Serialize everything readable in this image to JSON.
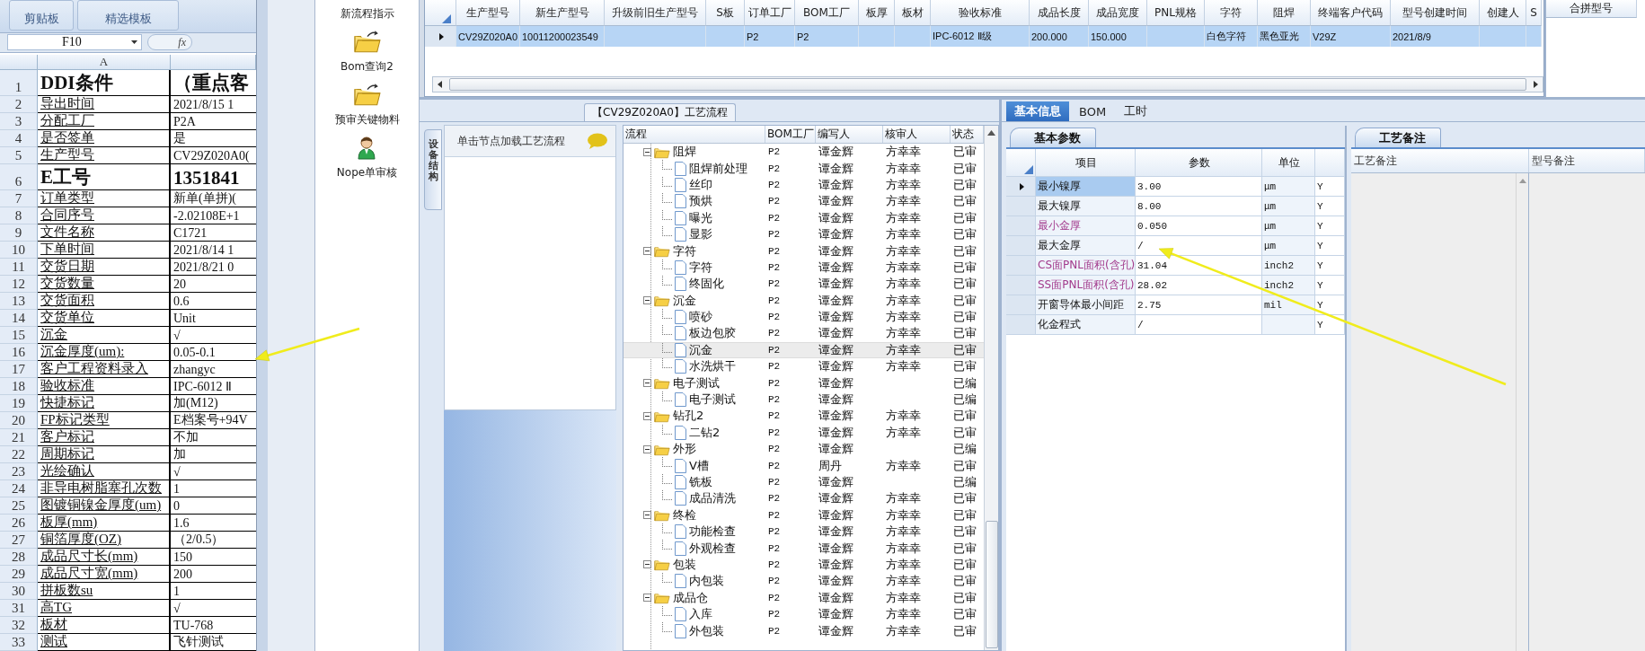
{
  "excel": {
    "ribbon_groups": [
      "剪贴板",
      "精选模板"
    ],
    "name_box": "F10",
    "formula_label": "fx",
    "column_header": "A",
    "rows": [
      {
        "num": "1",
        "a": "DDI条件",
        "b": "（重点客",
        "kind": "title"
      },
      {
        "num": "2",
        "a": "导出时间",
        "b": "2021/8/15 1",
        "kind": "normal"
      },
      {
        "num": "3",
        "a": "分配工厂",
        "b": "P2A",
        "kind": "normal"
      },
      {
        "num": "4",
        "a": "是否签单",
        "b": "是",
        "kind": "normal"
      },
      {
        "num": "5",
        "a": "生产型号",
        "b": "CV29Z020A0(",
        "kind": "normal"
      },
      {
        "num": "6",
        "a": "E工号",
        "b": "1351841",
        "kind": "title"
      },
      {
        "num": "7",
        "a": "订单类型",
        "b": "新单(单拼)(",
        "kind": "normal"
      },
      {
        "num": "8",
        "a": "合同序号",
        "b": "-2.02108E+1",
        "kind": "normal"
      },
      {
        "num": "9",
        "a": "文件名称",
        "b": "C1721",
        "kind": "normal"
      },
      {
        "num": "10",
        "a": "下单时间",
        "b": "2021/8/14 1",
        "kind": "normal"
      },
      {
        "num": "11",
        "a": "交货日期",
        "b": "2021/8/21 0",
        "kind": "normal"
      },
      {
        "num": "12",
        "a": "交货数量",
        "b": "20",
        "kind": "normal"
      },
      {
        "num": "13",
        "a": "交货面积",
        "b": "0.6",
        "kind": "normal"
      },
      {
        "num": "14",
        "a": "交货单位",
        "b": "Unit",
        "kind": "normal"
      },
      {
        "num": "15",
        "a": "沉金",
        "b": "√",
        "kind": "normal"
      },
      {
        "num": "16",
        "a": "沉金厚度(um):",
        "b": "0.05-0.1",
        "kind": "normal"
      },
      {
        "num": "17",
        "a": "客户工程资料录入",
        "b": "zhangyc",
        "kind": "normal"
      },
      {
        "num": "18",
        "a": "验收标准",
        "b": "IPC-6012 Ⅱ",
        "kind": "normal"
      },
      {
        "num": "19",
        "a": "快捷标记",
        "b": "加(M12)",
        "kind": "normal"
      },
      {
        "num": "20",
        "a": "FP标记类型",
        "b": "E档案号+94V",
        "kind": "normal"
      },
      {
        "num": "21",
        "a": "客户标记",
        "b": "不加",
        "kind": "normal"
      },
      {
        "num": "22",
        "a": "周期标记",
        "b": "加",
        "kind": "normal"
      },
      {
        "num": "23",
        "a": "光绘确认",
        "b": "√",
        "kind": "normal"
      },
      {
        "num": "24",
        "a": "非导电树脂塞孔次数",
        "b": "1",
        "kind": "normal"
      },
      {
        "num": "25",
        "a": "图镀铜镍金厚度(um)",
        "b": "0",
        "kind": "normal"
      },
      {
        "num": "26",
        "a": "板厚(mm)",
        "b": "1.6",
        "kind": "normal"
      },
      {
        "num": "27",
        "a": "铜箔厚度(OZ)",
        "b": "（2/0.5）",
        "kind": "normal"
      },
      {
        "num": "28",
        "a": "成品尺寸长(mm)",
        "b": "150",
        "kind": "normal"
      },
      {
        "num": "29",
        "a": "成品尺寸宽(mm)",
        "b": "200",
        "kind": "normal"
      },
      {
        "num": "30",
        "a": "拼板数su",
        "b": "1",
        "kind": "normal"
      },
      {
        "num": "31",
        "a": "高TG",
        "b": "√",
        "kind": "normal"
      },
      {
        "num": "32",
        "a": "板材",
        "b": "TU-768",
        "kind": "normal"
      },
      {
        "num": "33",
        "a": "测试",
        "b": "飞针测试",
        "kind": "normal"
      }
    ]
  },
  "nav": [
    {
      "label": "新流程指示",
      "kind": "label"
    },
    {
      "label": "Bom查询2",
      "kind": "folder"
    },
    {
      "label": "预审关键物料",
      "kind": "folder"
    },
    {
      "label": "Nope单审核",
      "kind": "person"
    }
  ],
  "top_grid": {
    "columns": [
      "生产型号",
      "新生产型号",
      "升级前旧生产型号",
      "S板",
      "订单工厂",
      "BOM工厂",
      "板厚",
      "板材",
      "验收标准",
      "成品长度",
      "成品宽度",
      "PNL规格",
      "字符",
      "阻焊",
      "终端客户代码",
      "型号创建时间",
      "创建人",
      "S"
    ],
    "rows": [
      {
        "selected": true,
        "cells": [
          "CV29Z020A0",
          "10011200023549",
          "",
          "",
          "P2",
          "P2",
          "",
          "",
          "IPC-6012 Ⅱ级",
          "200.000",
          "150.000",
          "",
          "白色字符",
          "黑色亚光",
          "V29Z",
          "2021/8/9",
          "",
          ""
        ]
      }
    ]
  },
  "merge_panel": {
    "header": "合拼型号"
  },
  "process": {
    "title": "【CV29Z020A0】工艺流程",
    "side_tab": "设备结构",
    "hint": "单击节点加载工艺流程",
    "columns": [
      "流程",
      "BOM工厂",
      "编写人",
      "核审人",
      "状态"
    ],
    "tree": [
      {
        "name": "阻焊",
        "bom": "P2",
        "author": "谭金辉",
        "reviewer": "方幸幸",
        "status": "已审",
        "expanded": true,
        "selected": false,
        "children": [
          {
            "name": "阻焊前处理",
            "bom": "P2",
            "author": "谭金辉",
            "reviewer": "方幸幸",
            "status": "已审",
            "selected": false
          },
          {
            "name": "丝印",
            "bom": "P2",
            "author": "谭金辉",
            "reviewer": "方幸幸",
            "status": "已审",
            "selected": false
          },
          {
            "name": "预烘",
            "bom": "P2",
            "author": "谭金辉",
            "reviewer": "方幸幸",
            "status": "已审",
            "selected": false
          },
          {
            "name": "曝光",
            "bom": "P2",
            "author": "谭金辉",
            "reviewer": "方幸幸",
            "status": "已审",
            "selected": false
          },
          {
            "name": "显影",
            "bom": "P2",
            "author": "谭金辉",
            "reviewer": "方幸幸",
            "status": "已审",
            "selected": false
          }
        ]
      },
      {
        "name": "字符",
        "bom": "P2",
        "author": "谭金辉",
        "reviewer": "方幸幸",
        "status": "已审",
        "expanded": true,
        "selected": false,
        "children": [
          {
            "name": "字符",
            "bom": "P2",
            "author": "谭金辉",
            "reviewer": "方幸幸",
            "status": "已审",
            "selected": false
          },
          {
            "name": "终固化",
            "bom": "P2",
            "author": "谭金辉",
            "reviewer": "方幸幸",
            "status": "已审",
            "selected": false
          }
        ]
      },
      {
        "name": "沉金",
        "bom": "P2",
        "author": "谭金辉",
        "reviewer": "方幸幸",
        "status": "已审",
        "expanded": true,
        "selected": false,
        "children": [
          {
            "name": "喷砂",
            "bom": "P2",
            "author": "谭金辉",
            "reviewer": "方幸幸",
            "status": "已审",
            "selected": false
          },
          {
            "name": "板边包胶",
            "bom": "P2",
            "author": "谭金辉",
            "reviewer": "方幸幸",
            "status": "已审",
            "selected": false
          },
          {
            "name": "沉金",
            "bom": "P2",
            "author": "谭金辉",
            "reviewer": "方幸幸",
            "status": "已审",
            "selected": true
          },
          {
            "name": "水洗烘干",
            "bom": "P2",
            "author": "谭金辉",
            "reviewer": "方幸幸",
            "status": "已审",
            "selected": false
          }
        ]
      },
      {
        "name": "电子测试",
        "bom": "P2",
        "author": "谭金辉",
        "status": "已编",
        "expanded": true,
        "selected": false,
        "children": [
          {
            "name": "电子测试",
            "bom": "P2",
            "author": "谭金辉",
            "status": "已编",
            "selected": false
          }
        ]
      },
      {
        "name": "钻孔2",
        "bom": "P2",
        "author": "谭金辉",
        "reviewer": "方幸幸",
        "status": "已审",
        "expanded": true,
        "selected": false,
        "children": [
          {
            "name": "二钻2",
            "bom": "P2",
            "author": "谭金辉",
            "reviewer": "方幸幸",
            "status": "已审",
            "selected": false
          }
        ]
      },
      {
        "name": "外形",
        "bom": "P2",
        "author": "谭金辉",
        "status": "已编",
        "expanded": true,
        "selected": false,
        "children": [
          {
            "name": "V槽",
            "bom": "P2",
            "author": "周丹",
            "reviewer": "方幸幸",
            "status": "已审",
            "selected": false
          },
          {
            "name": "铣板",
            "bom": "P2",
            "author": "谭金辉",
            "status": "已编",
            "selected": false
          },
          {
            "name": "成品清洗",
            "bom": "P2",
            "author": "谭金辉",
            "reviewer": "方幸幸",
            "status": "已审",
            "selected": false
          }
        ]
      },
      {
        "name": "终检",
        "bom": "P2",
        "author": "谭金辉",
        "reviewer": "方幸幸",
        "status": "已审",
        "expanded": true,
        "selected": false,
        "children": [
          {
            "name": "功能检查",
            "bom": "P2",
            "author": "谭金辉",
            "reviewer": "方幸幸",
            "status": "已审",
            "selected": false
          },
          {
            "name": "外观检查",
            "bom": "P2",
            "author": "谭金辉",
            "reviewer": "方幸幸",
            "status": "已审",
            "selected": false
          }
        ]
      },
      {
        "name": "包装",
        "bom": "P2",
        "author": "谭金辉",
        "reviewer": "方幸幸",
        "status": "已审",
        "expanded": true,
        "selected": false,
        "children": [
          {
            "name": "内包装",
            "bom": "P2",
            "author": "谭金辉",
            "reviewer": "方幸幸",
            "status": "已审",
            "selected": false
          }
        ]
      },
      {
        "name": "成品仓",
        "bom": "P2",
        "author": "谭金辉",
        "reviewer": "方幸幸",
        "status": "已审",
        "expanded": true,
        "selected": false,
        "children": [
          {
            "name": "入库",
            "bom": "P2",
            "author": "谭金辉",
            "reviewer": "方幸幸",
            "status": "已审",
            "selected": false
          },
          {
            "name": "外包装",
            "bom": "P2",
            "author": "谭金辉",
            "reviewer": "方幸幸",
            "status": "已审",
            "selected": false
          }
        ]
      }
    ]
  },
  "detail": {
    "tabs": [
      {
        "label": "基本信息",
        "selected": true
      },
      {
        "label": "BOM",
        "selected": false
      },
      {
        "label": "工时",
        "selected": false
      }
    ],
    "params": {
      "tab": "基本参数",
      "columns": [
        "项目",
        "参数",
        "单位"
      ],
      "rows": [
        {
          "item": "最小镍厚",
          "value": "3.00",
          "unit": "μm",
          "flag": "Y",
          "emphasized": false,
          "selected": true
        },
        {
          "item": "最大镍厚",
          "value": "8.00",
          "unit": "μm",
          "flag": "Y",
          "emphasized": false,
          "selected": false
        },
        {
          "item": "最小金厚",
          "value": "0.050",
          "unit": "μm",
          "flag": "Y",
          "emphasized": true,
          "selected": false
        },
        {
          "item": "最大金厚",
          "value": "/",
          "unit": "μm",
          "flag": "Y",
          "emphasized": false,
          "selected": false
        },
        {
          "item": "CS面PNL面积(含孔)",
          "value": "31.04",
          "unit": "inch2",
          "flag": "Y",
          "emphasized": true,
          "selected": false
        },
        {
          "item": "SS面PNL面积(含孔)",
          "value": "28.02",
          "unit": "inch2",
          "flag": "Y",
          "emphasized": true,
          "selected": false
        },
        {
          "item": "开窗导体最小间距",
          "value": "2.75",
          "unit": "mil",
          "flag": "Y",
          "emphasized": false,
          "selected": false
        },
        {
          "item": "化金程式",
          "value": "/",
          "unit": "",
          "flag": "Y",
          "emphasized": false,
          "selected": false
        }
      ]
    },
    "notes": {
      "tab": "工艺备注",
      "columns": [
        "工艺备注",
        "型号备注"
      ]
    }
  }
}
